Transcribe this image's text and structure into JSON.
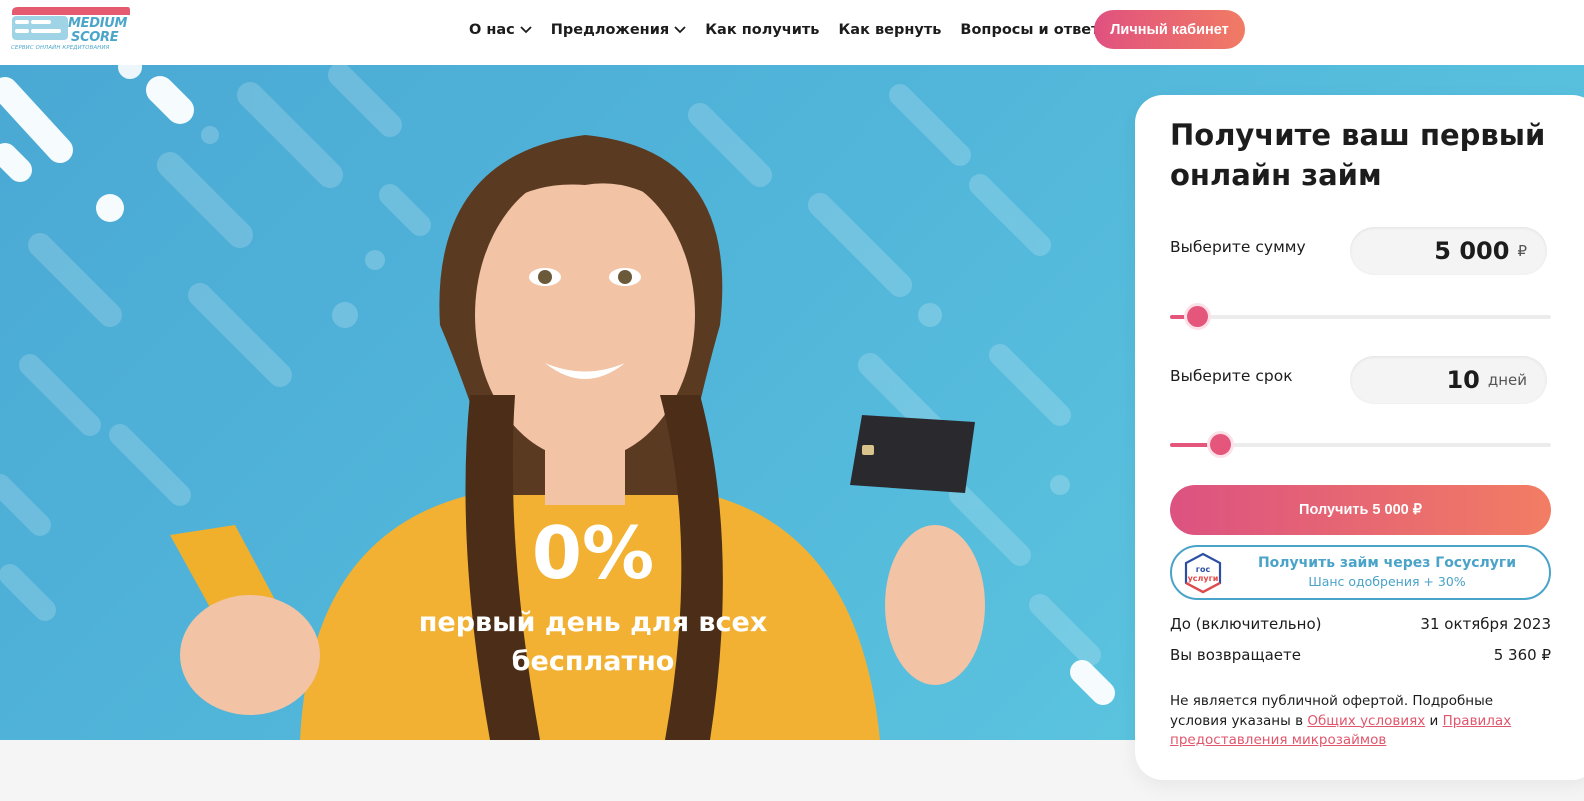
{
  "header": {
    "logo": {
      "title_line1": "MEDIUM",
      "title_line2": "SCORE",
      "subtitle": "СЕРВИС ОНЛАЙН КРЕДИТОВАНИЯ"
    },
    "nav": [
      {
        "label": "О нас",
        "has_dropdown": true
      },
      {
        "label": "Предложения",
        "has_dropdown": true
      },
      {
        "label": "Как получить",
        "has_dropdown": false
      },
      {
        "label": "Как вернуть",
        "has_dropdown": false
      },
      {
        "label": "Вопросы и ответы",
        "has_dropdown": false
      }
    ],
    "cabinet_label": "Личный кабинет"
  },
  "hero": {
    "promo_big": "0%",
    "promo_small": "первый день для всех бесплатно"
  },
  "calculator": {
    "title": "Получите ваш первый онлайн займ",
    "amount": {
      "label": "Выберите сумму",
      "value": "5 000",
      "unit": "₽",
      "slider_fraction": 0.07
    },
    "term": {
      "label": "Выберите срок",
      "value": "10",
      "unit": "дней",
      "slider_fraction": 0.13
    },
    "get_button": "Получить 5 000 ₽",
    "gosuslugi": {
      "logo_top": "гос",
      "logo_bottom": "услуги",
      "main": "Получить займ через Госуслуги",
      "sub": "Шанс одобрения + 30%"
    },
    "due": {
      "label": "До (включительно)",
      "value": "31 октября 2023"
    },
    "repay": {
      "label": "Вы возвращаете",
      "value": "5 360 ₽"
    },
    "disclaimer": {
      "text1": "Не является публичной офертой. Подробные условия указаны в ",
      "link1": "Общих условиях",
      "text2": " и ",
      "link2": "Правилах предостав­ления микрозаймов"
    }
  },
  "colors": {
    "accent": "#e4567b",
    "accent_end": "#f27d63",
    "brand_blue": "#4aa6c9",
    "hero_bg": "#52b6da"
  }
}
